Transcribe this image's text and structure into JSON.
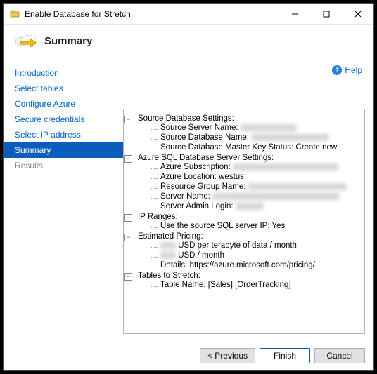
{
  "window": {
    "title": "Enable Database for Stretch"
  },
  "header": {
    "title": "Summary"
  },
  "sidebar": {
    "items": [
      {
        "label": "Introduction"
      },
      {
        "label": "Select tables"
      },
      {
        "label": "Configure Azure"
      },
      {
        "label": "Secure credentials"
      },
      {
        "label": "Select IP address"
      },
      {
        "label": "Summary"
      },
      {
        "label": "Results"
      }
    ],
    "selected_index": 5
  },
  "help": {
    "label": "Help"
  },
  "summary_tree": {
    "source_db": {
      "heading": "Source Database Settings:",
      "server_name_label": "Source Server Name:",
      "database_name_label": "Source Database Name:",
      "master_key_label": "Source Database Master Key Status:",
      "master_key_value": "Create new"
    },
    "azure_server": {
      "heading": "Azure SQL Database Server Settings:",
      "subscription_label": "Azure Subscription:",
      "location_label": "Azure Location:",
      "location_value": "westus",
      "resource_group_label": "Resource Group Name:",
      "server_name_label": "Server Name:",
      "admin_login_label": "Server Admin Login:"
    },
    "ip_ranges": {
      "heading": "IP Ranges:",
      "use_source_label": "Use the source SQL server IP:",
      "use_source_value": "Yes"
    },
    "pricing": {
      "heading": "Estimated Pricing:",
      "per_tb_suffix": " USD per terabyte of data / month",
      "per_month_suffix": " USD / month",
      "details_label": "Details:",
      "details_value": "https://azure.microsoft.com/pricing/"
    },
    "tables": {
      "heading": "Tables to Stretch:",
      "table_name_label": "Table Name:",
      "table_name_value": "[Sales].[OrderTracking]"
    }
  },
  "footer": {
    "previous": "< Previous",
    "finish": "Finish",
    "cancel": "Cancel"
  }
}
